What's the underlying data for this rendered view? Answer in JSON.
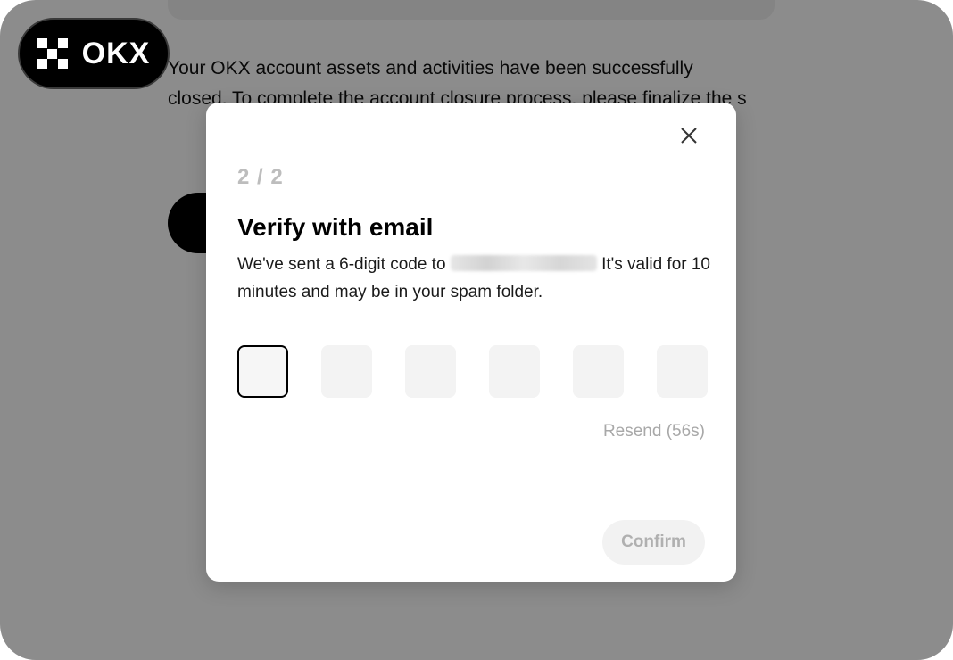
{
  "logo": {
    "text": "OKX"
  },
  "background": {
    "message": "Your OKX account assets and activities have been successfully closed. To complete the account closure process, please finalize the s"
  },
  "modal": {
    "step": "2 / 2",
    "title": "Verify with email",
    "description_before": "We've sent a 6-digit code to ",
    "description_after": " It's valid for 10 minutes and may be in your spam folder.",
    "code_digits": [
      "",
      "",
      "",
      "",
      "",
      ""
    ],
    "resend_label": "Resend (56s)",
    "confirm_label": "Confirm"
  },
  "icons": {
    "close": "close-icon",
    "logo_mark": "okx-logo-icon",
    "masked_email": "blurred-email"
  }
}
